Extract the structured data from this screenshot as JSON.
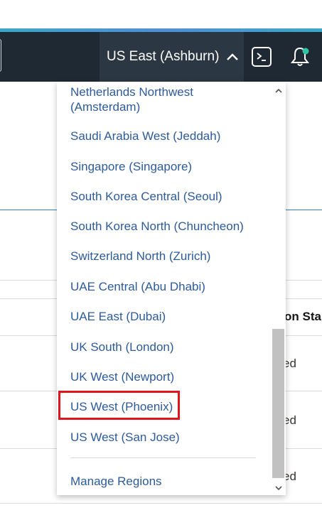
{
  "header": {
    "region_label": "US East (Ashburn)"
  },
  "background": {
    "column_header": "on Sta",
    "cells": [
      "ed",
      "ed",
      "ed"
    ]
  },
  "region_menu": {
    "items": [
      "Netherlands Northwest (Amsterdam)",
      "Saudi Arabia West (Jeddah)",
      "Singapore (Singapore)",
      "South Korea Central (Seoul)",
      "South Korea North (Chuncheon)",
      "Switzerland North (Zurich)",
      "UAE Central (Abu Dhabi)",
      "UAE East (Dubai)",
      "UK South (London)",
      "UK West (Newport)",
      "US West (Phoenix)",
      "US West (San Jose)"
    ],
    "manage_label": "Manage Regions",
    "highlighted_item": "US West (Phoenix)"
  },
  "colors": {
    "header_bg": "#1f2933",
    "region_button_bg": "#2b3742",
    "link": "#2d5b9a",
    "highlight": "#e0141d",
    "notification_dot": "#2ec4a5"
  },
  "icons": [
    "chevron-up-icon",
    "cloud-shell-icon",
    "bell-icon",
    "scroll-up-arrow-icon",
    "scroll-down-arrow-icon"
  ]
}
